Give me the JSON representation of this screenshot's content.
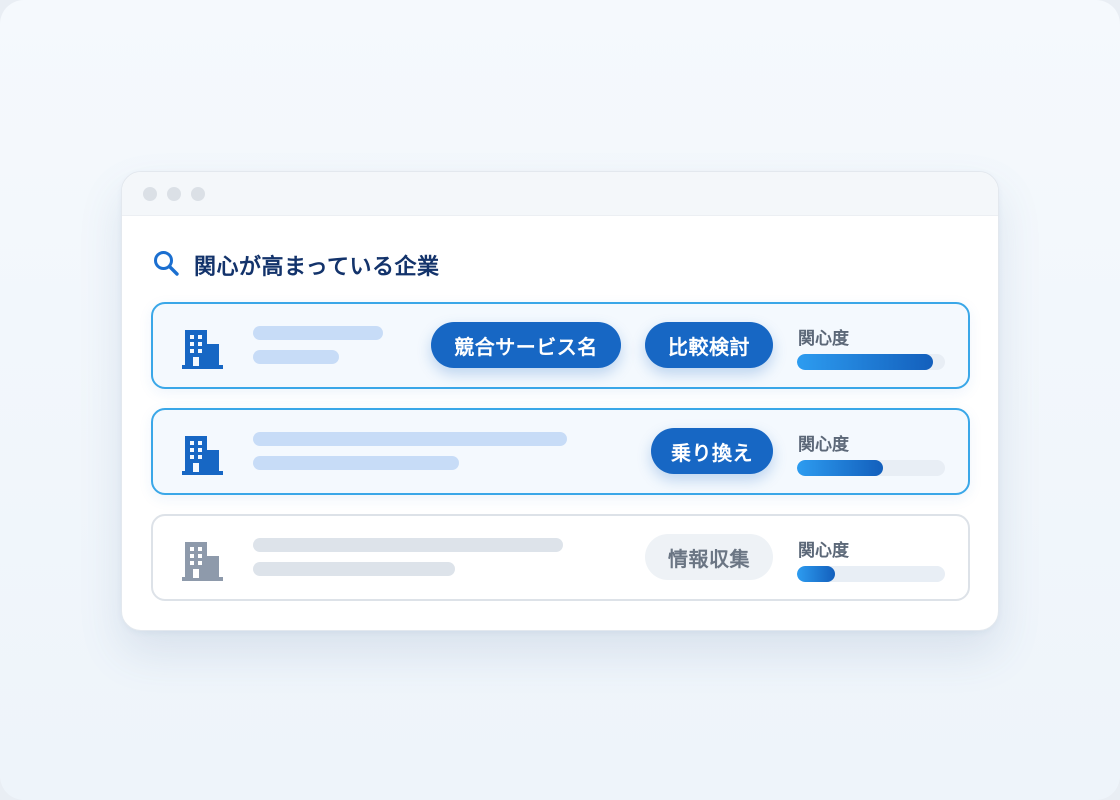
{
  "window": {
    "dots": [
      "close",
      "minimize",
      "maximize"
    ]
  },
  "header": {
    "icon": "search-icon",
    "title": "関心が高まっている企業"
  },
  "colors": {
    "accent": "#1767c4",
    "heading": "#13336b",
    "active_border": "#3aa7e8",
    "muted_tag_text": "#6b7684"
  },
  "companies": [
    {
      "icon": "building-icon",
      "active": true,
      "tags": [
        "競合サービス名",
        "比較検討"
      ],
      "interest_label": "関心度",
      "interest_level": 0.92
    },
    {
      "icon": "building-icon",
      "active": true,
      "tags": [
        "乗り換え"
      ],
      "interest_label": "関心度",
      "interest_level": 0.58
    },
    {
      "icon": "building-icon",
      "active": false,
      "tags": [
        "情報収集"
      ],
      "interest_label": "関心度",
      "interest_level": 0.26
    }
  ]
}
